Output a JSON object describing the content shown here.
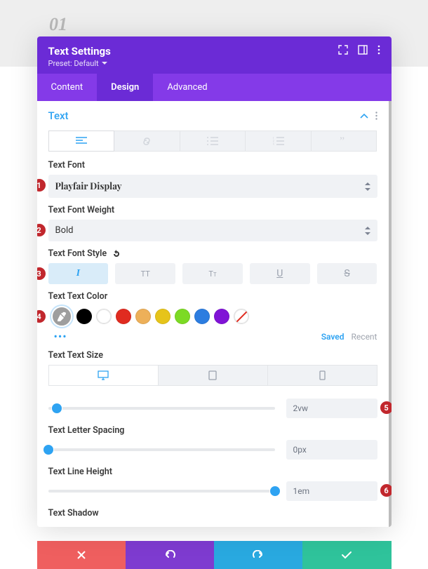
{
  "step_number": "01",
  "modal": {
    "title": "Text Settings",
    "preset": "Preset: Default"
  },
  "tabs": {
    "content": "Content",
    "design": "Design",
    "advanced": "Advanced"
  },
  "section": {
    "title": "Text"
  },
  "labels": {
    "font": "Text Font",
    "weight": "Text Font Weight",
    "style": "Text Font Style",
    "color": "Text Text Color",
    "size": "Text Text Size",
    "spacing": "Text Letter Spacing",
    "lineheight": "Text Line Height",
    "shadow": "Text Shadow"
  },
  "values": {
    "font": "Playfair Display",
    "weight": "Bold",
    "size": "2vw",
    "spacing": "0px",
    "lineheight": "1em"
  },
  "colors": {
    "swatch_tabs": {
      "saved": "Saved",
      "recent": "Recent"
    },
    "swatches": [
      "picker",
      "black",
      "white",
      "red",
      "orange",
      "yellow",
      "green",
      "blue",
      "purple",
      "none"
    ]
  },
  "markers": [
    "1",
    "2",
    "3",
    "4",
    "5",
    "6"
  ]
}
